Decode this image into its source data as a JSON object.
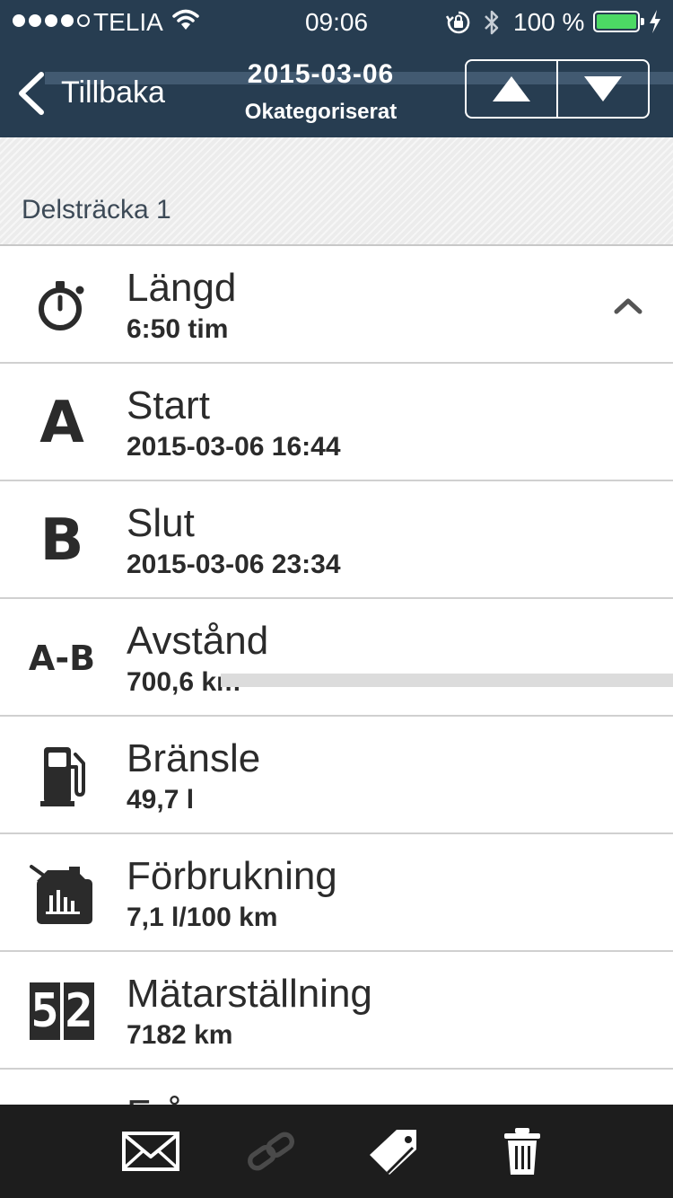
{
  "status_bar": {
    "carrier": "TELIA",
    "time": "09:06",
    "battery": "100 %",
    "battery_level": 1.0
  },
  "nav": {
    "back_label": "Tillbaka",
    "title": "2015-03-06",
    "subtitle": "Okategoriserat"
  },
  "section": {
    "label": "Delsträcka  1"
  },
  "rows": [
    {
      "icon": "stopwatch-icon",
      "label": "Längd",
      "value": "6:50 tim"
    },
    {
      "icon": "letter-a-icon",
      "label": "Start",
      "value": "2015-03-06 16:44",
      "icon_text": "A"
    },
    {
      "icon": "letter-b-icon",
      "label": "Slut",
      "value": "2015-03-06 23:34",
      "icon_text": "B"
    },
    {
      "icon": "a-to-b-icon",
      "label": "Avstånd",
      "value": "700,6 km",
      "icon_text": "A-B"
    },
    {
      "icon": "fuel-pump-icon",
      "label": "Bränsle",
      "value": "49,7 l"
    },
    {
      "icon": "fuel-can-icon",
      "label": "Förbrukning",
      "value": "7,1 l/100 km"
    },
    {
      "icon": "odometer-icon",
      "label": "Mätarställning",
      "value": "7182 km",
      "icon_text": "52"
    },
    {
      "label": "Frå"
    }
  ],
  "toolbar": {
    "icons": [
      "mail-icon",
      "link-icon",
      "tag-icon",
      "trash-icon"
    ]
  },
  "colors": {
    "nav_bg": "#273d51",
    "toolbar_bg": "#1d1d1d",
    "battery_fill": "#4cd964",
    "text": "#2b2b2b"
  }
}
